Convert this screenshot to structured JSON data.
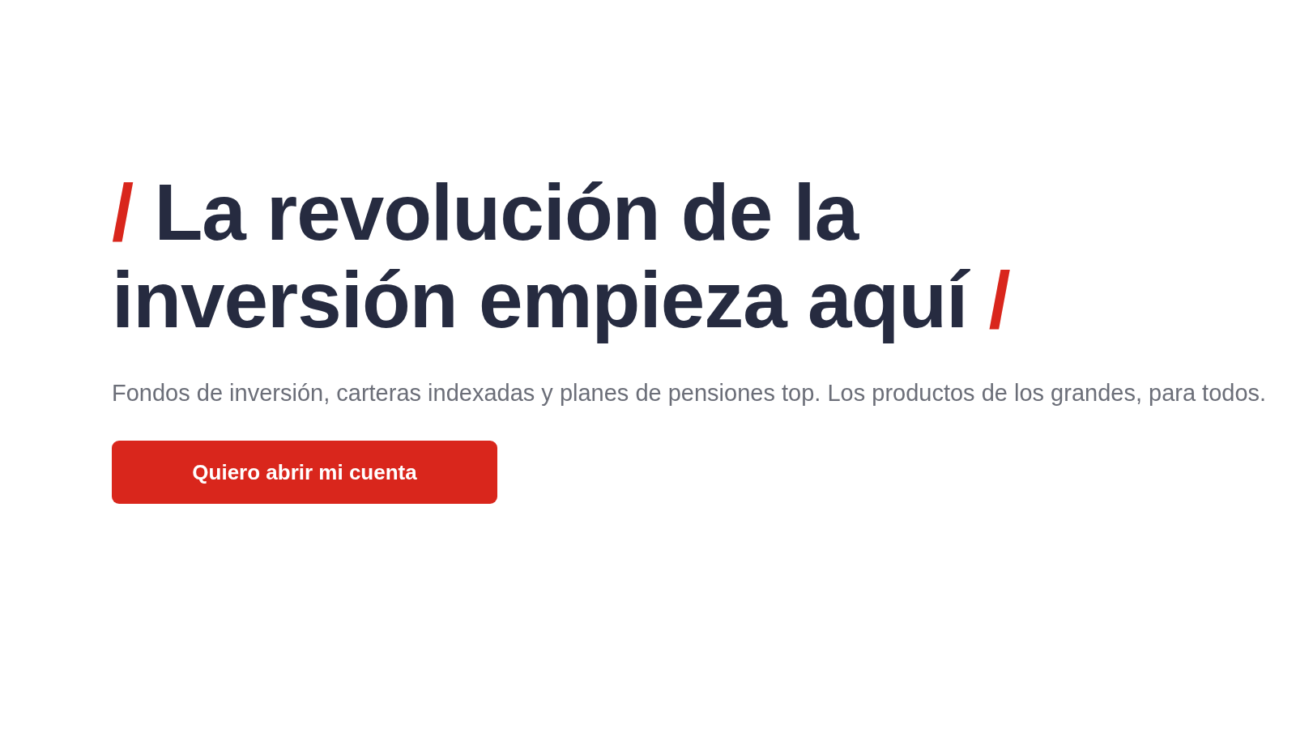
{
  "hero": {
    "headline": {
      "lead_mark": "/",
      "text": "La revolución de la inversión empieza aquí",
      "trail_mark": "/"
    },
    "subtitle": "Fondos de inversión, carteras indexadas y planes de pensiones top. Los productos de los grandes, para todos.",
    "cta_button": "Quiero abrir mi cuenta"
  }
}
